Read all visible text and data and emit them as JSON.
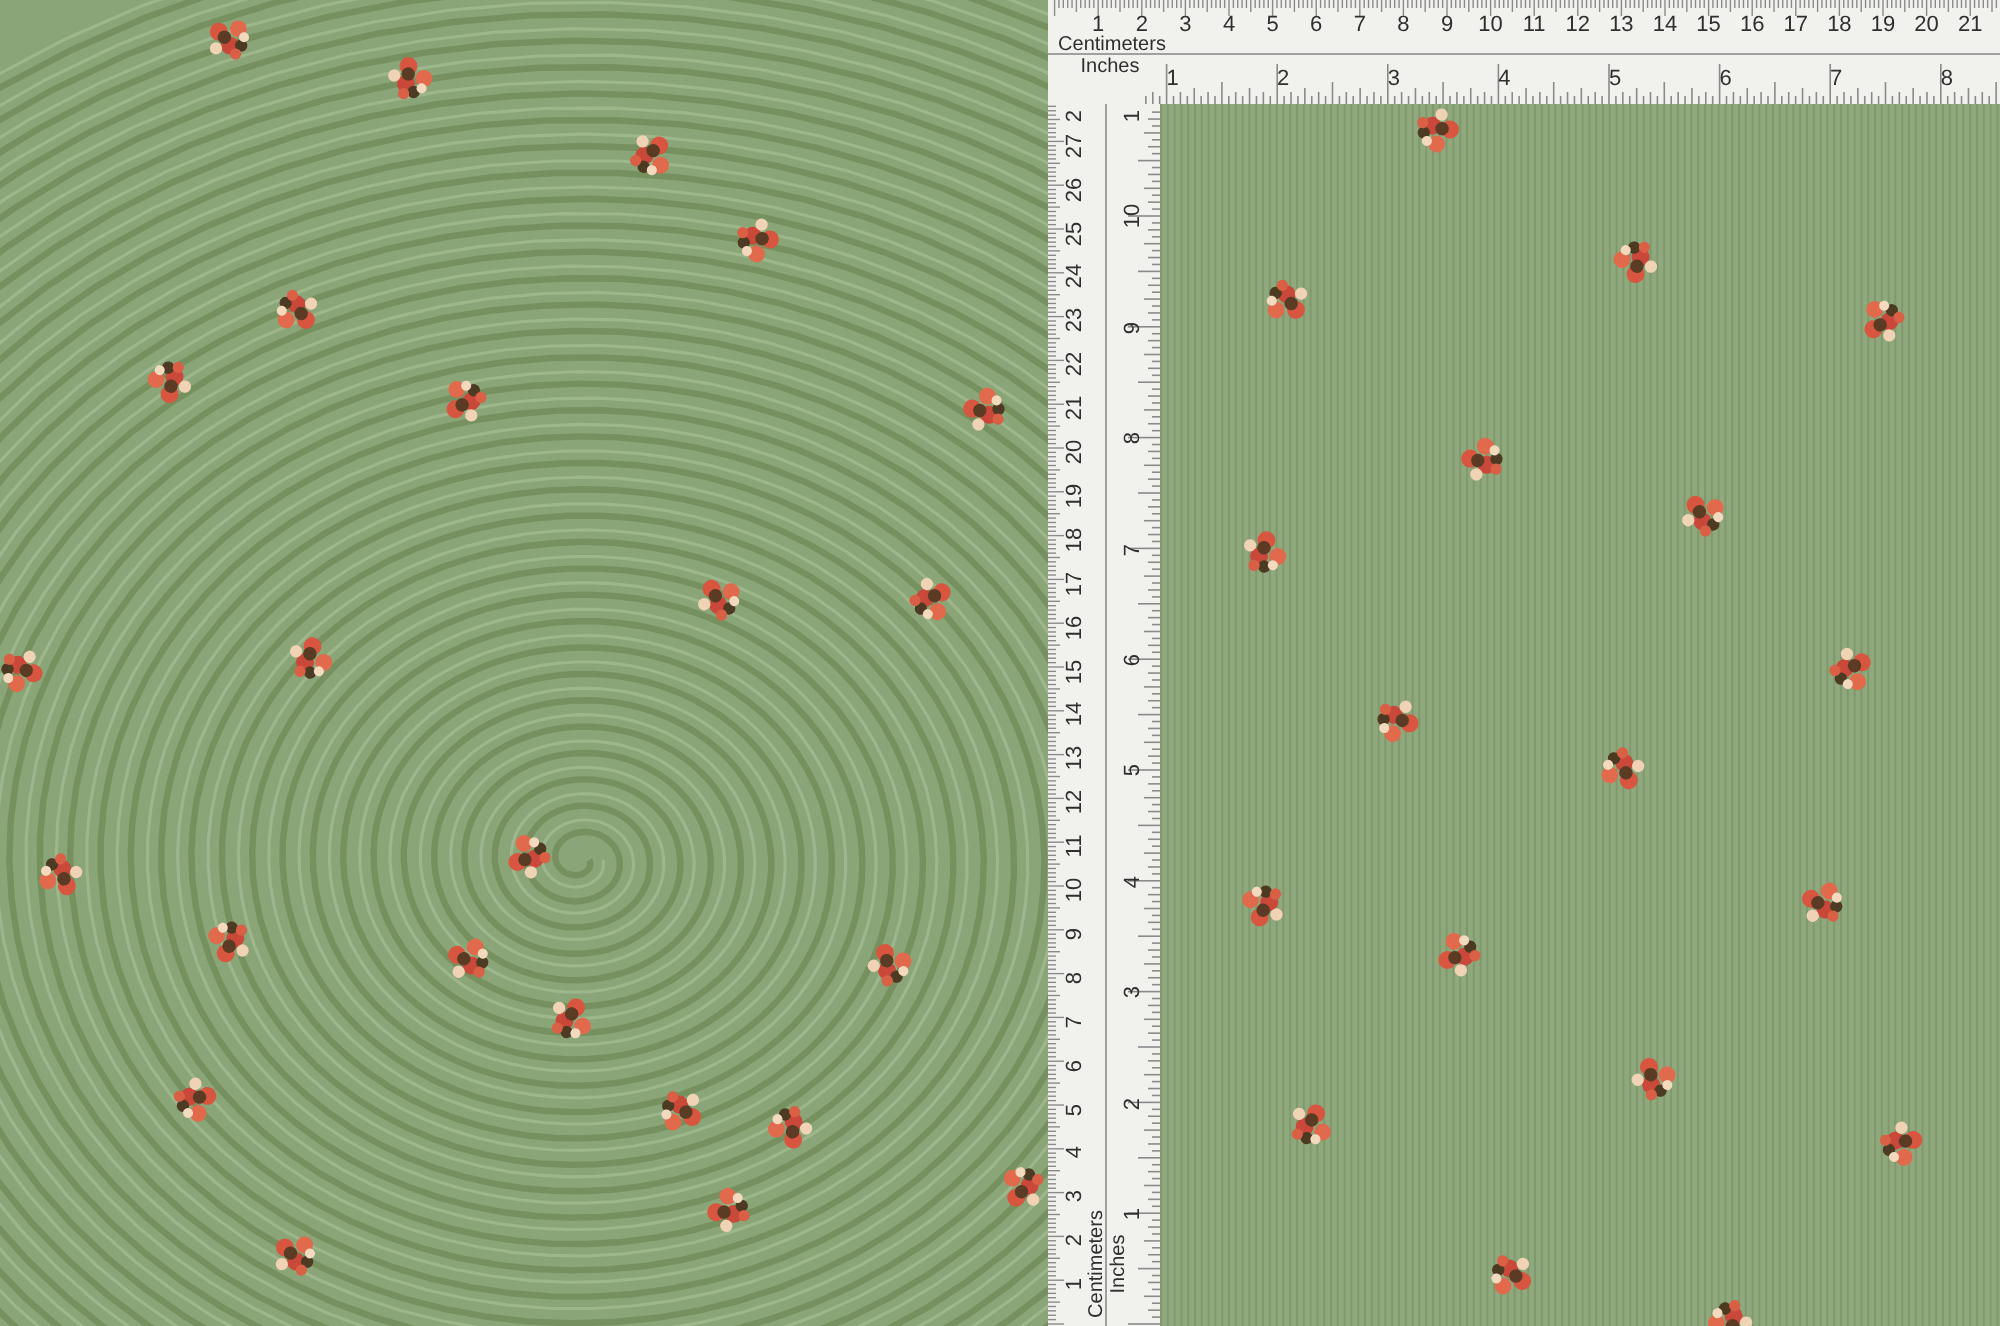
{
  "horizontal_ruler": {
    "cm_label": "Centimeters",
    "cm_numbers": [
      "1",
      "2",
      "3",
      "4",
      "5",
      "6",
      "7",
      "8",
      "9",
      "10",
      "11",
      "12",
      "13",
      "14",
      "15",
      "16",
      "17",
      "18",
      "19",
      "20",
      "21"
    ],
    "inch_label": "Inches",
    "inch_numbers": [
      "1",
      "2",
      "3",
      "4",
      "5",
      "6",
      "7",
      "8"
    ]
  },
  "vertical_ruler": {
    "cm_label": "Centimeters",
    "cm_numbers": [
      "1",
      "2",
      "3",
      "4",
      "5",
      "6",
      "7",
      "8",
      "9",
      "10",
      "11",
      "12",
      "13",
      "14",
      "15",
      "16",
      "17",
      "18",
      "19",
      "20",
      "21",
      "22",
      "23",
      "24",
      "25",
      "26",
      "27",
      "2"
    ],
    "inch_label": "Inches",
    "inch_numbers": [
      "1",
      "2",
      "3",
      "4",
      "5",
      "6",
      "7",
      "8",
      "9",
      "10",
      "1"
    ]
  }
}
